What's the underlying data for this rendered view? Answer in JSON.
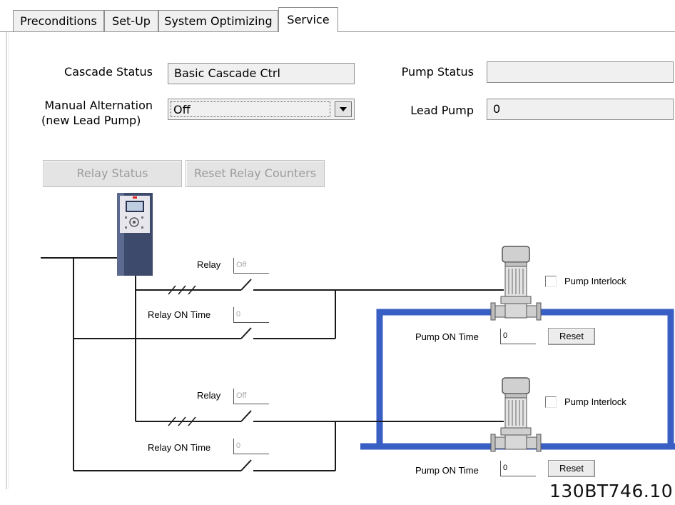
{
  "tabs": [
    {
      "label": "Preconditions"
    },
    {
      "label": "Set-Up"
    },
    {
      "label": "System Optimizing"
    },
    {
      "label": "Service",
      "active": true
    }
  ],
  "form": {
    "cascade_status_label": "Cascade Status",
    "cascade_status_value": "Basic Cascade Ctrl",
    "manual_alternation_label_line1": "Manual Alternation",
    "manual_alternation_label_line2": "(new Lead Pump)",
    "manual_alternation_value": "Off",
    "pump_status_label": "Pump Status",
    "pump_status_value": "",
    "lead_pump_label": "Lead Pump",
    "lead_pump_value": "0"
  },
  "buttons": {
    "relay_status": "Relay Status",
    "reset_relay_counters": "Reset Relay Counters"
  },
  "pumps": [
    {
      "relay_label": "Relay",
      "relay_value": "Off",
      "relay_on_time_label": "Relay ON Time",
      "relay_on_time_value": "0",
      "interlock_label": "Pump Interlock",
      "interlock_checked": false,
      "pump_on_time_label": "Pump ON Time",
      "pump_on_time_value": "0",
      "reset_label": "Reset"
    },
    {
      "relay_label": "Relay",
      "relay_value": "Off",
      "relay_on_time_label": "Relay ON Time",
      "relay_on_time_value": "0",
      "interlock_label": "Pump Interlock",
      "interlock_checked": false,
      "pump_on_time_label": "Pump ON Time",
      "pump_on_time_value": "0",
      "reset_label": "Reset"
    }
  ],
  "figure_code": "130BT746.10",
  "colors": {
    "pipe": "#3a5fc4",
    "drive_body": "#3d4a6b",
    "wire": "#1a1a1a",
    "disabled_text": "#9c9c9c"
  },
  "icons": {
    "drive": "frequency-converter-icon",
    "pump": "vertical-pump-icon",
    "dropdown": "chevron-down-icon"
  }
}
